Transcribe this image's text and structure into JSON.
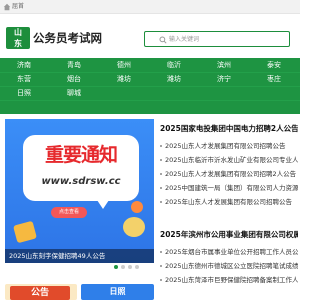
{
  "topbar": {
    "home_label": "屈首"
  },
  "logo": {
    "seal_char_1": "山",
    "seal_char_2": "东",
    "name": "公务员考试网"
  },
  "search": {
    "placeholder": "输入关键词"
  },
  "nav": {
    "rows": [
      [
        "济南",
        "青岛",
        "德州",
        "临沂",
        "滨州",
        "泰安"
      ],
      [
        "东营",
        "烟台",
        "潍坊",
        "潍坊",
        "济宁",
        "枣庄"
      ],
      [
        "日照",
        "聊城",
        "",
        "",
        "",
        ""
      ],
      [
        "",
        "",
        "",
        "",
        "",
        ""
      ]
    ]
  },
  "banner": {
    "title": "重要通知",
    "url": "www.sdrsw.cc",
    "cta": "点击查看",
    "caption": "2025山东刻字保健招聘49人公告"
  },
  "news": {
    "headline_1": "2025国家电投集团中国电力招聘2人公告",
    "items_1": [
      "2025山东人才发展集团有限公司招聘公告",
      "2025山东临沂市沂水发山矿业有限公司专业人才…",
      "2025山东人才发展集团有限公司招聘2人公告",
      "2025中国建筑一局（集团）有限公司人力资源部招…",
      "2025年山东人才发展集团有限公司招聘公告"
    ],
    "headline_2": "2025年滨州市公用事业集团有限公司权属公司…",
    "items_2": [
      "2025年烟台市属事业单位公开招聘工作人员公示…",
      "2025山东德州市德城区公立医院招聘笔试成绩公示",
      "2025山东菏泽市巨野保健院招聘备案制工作人员公…"
    ]
  },
  "thumbs": {
    "thumb1_text": "公告",
    "thumb2_text": "日照"
  },
  "colors": {
    "brand_green": "#1e9442",
    "banner_blue": "#2b7ff0",
    "alert_red": "#e6292d"
  }
}
